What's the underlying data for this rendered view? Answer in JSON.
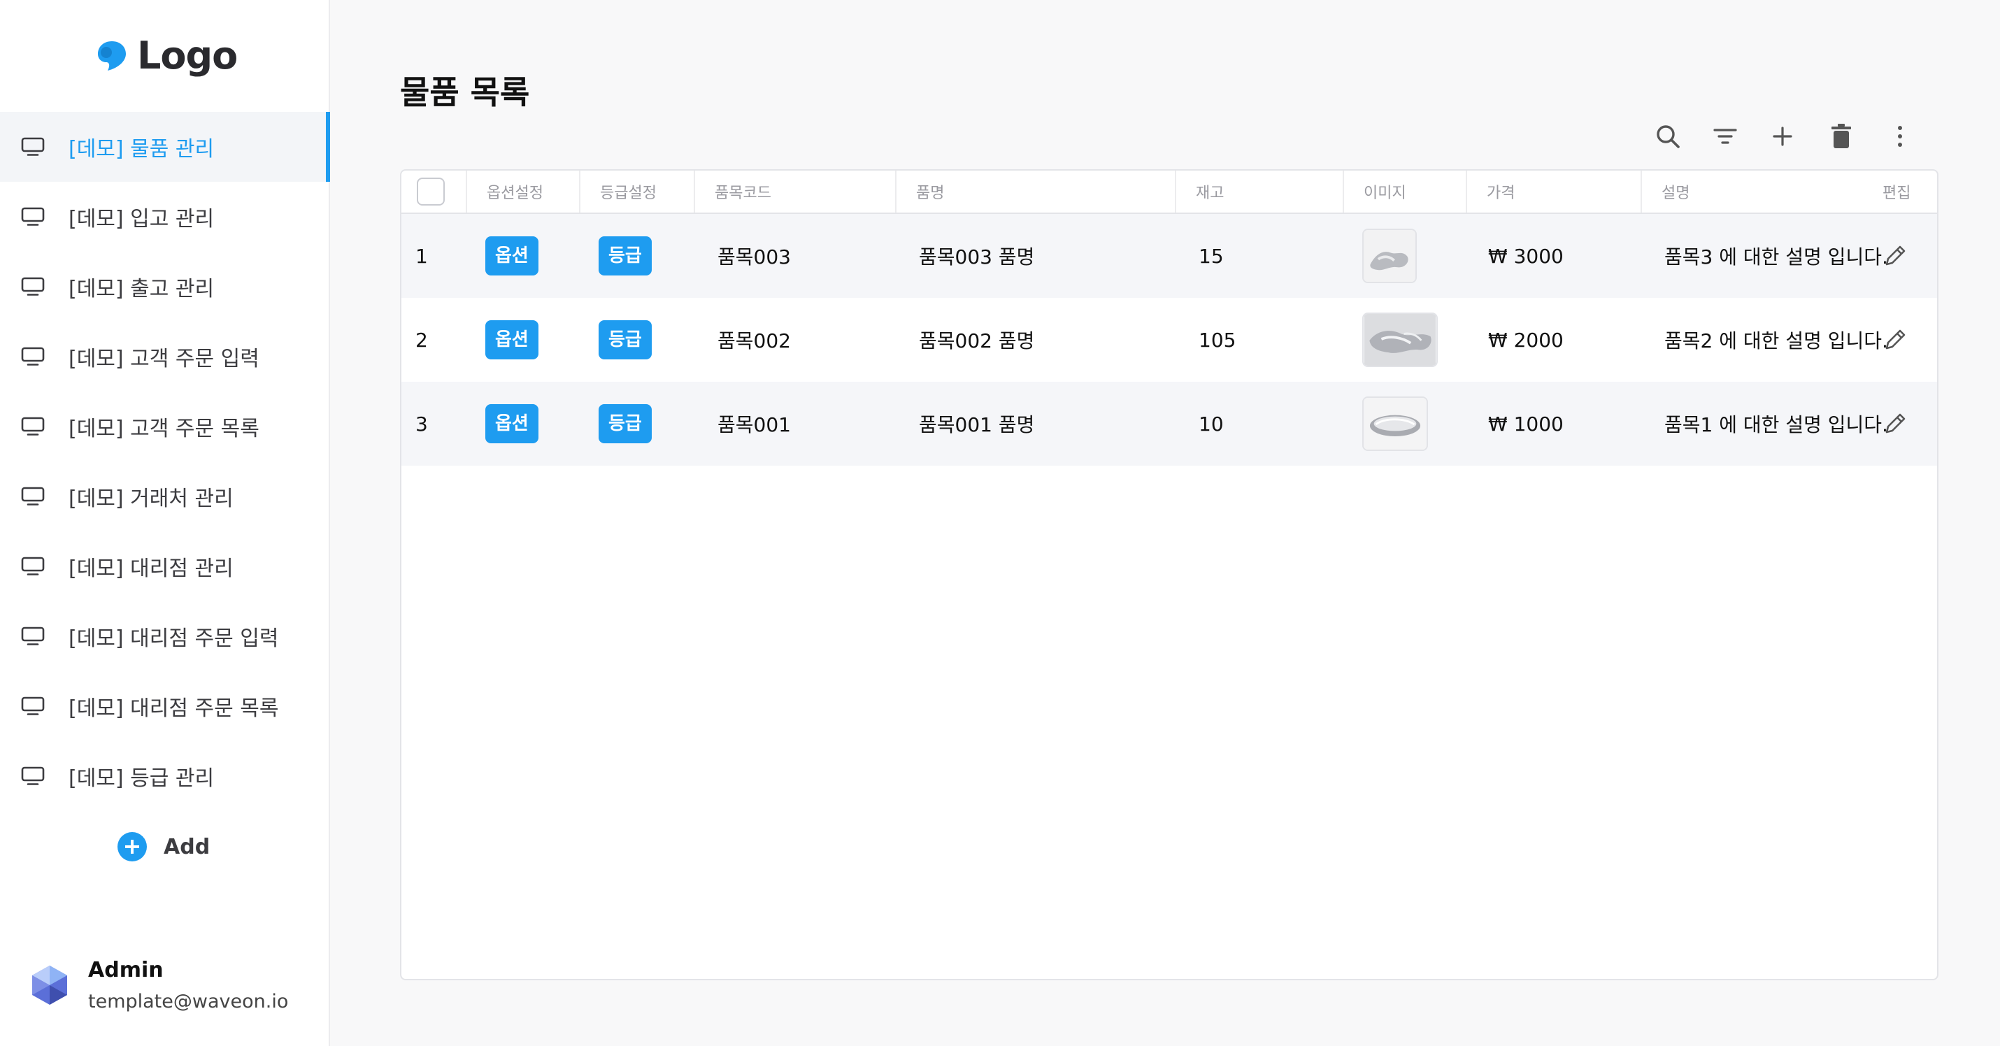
{
  "brand": {
    "logo_text": "Logo",
    "accent": "#1e9cf0"
  },
  "sidebar": {
    "items": [
      {
        "label": "[데모] 물품 관리",
        "active": true
      },
      {
        "label": "[데모] 입고 관리"
      },
      {
        "label": "[데모] 출고 관리"
      },
      {
        "label": "[데모] 고객 주문 입력"
      },
      {
        "label": "[데모] 고객 주문 목록"
      },
      {
        "label": "[데모] 거래처 관리"
      },
      {
        "label": "[데모] 대리점 관리"
      },
      {
        "label": "[데모] 대리점 주문 입력"
      },
      {
        "label": "[데모] 대리점 주문 목록"
      },
      {
        "label": "[데모] 등급 관리"
      }
    ],
    "add_label": "Add",
    "icon": "monitor-icon"
  },
  "user": {
    "name": "Admin",
    "email": "template@waveon.io"
  },
  "page": {
    "title": "물품 목록"
  },
  "toolbar": {
    "icons": [
      "search-icon",
      "filter-icon",
      "plus-icon",
      "trash-icon",
      "more-vertical-icon"
    ]
  },
  "table": {
    "headers": {
      "option": "옵션설정",
      "grade": "등급설정",
      "code": "품목코드",
      "name": "품명",
      "stock": "재고",
      "image": "이미지",
      "price": "가격",
      "desc": "설명",
      "edit": "편집"
    },
    "rows": [
      {
        "no": "1",
        "option": "옵션",
        "grade": "등급",
        "code": "품목003",
        "name": "품목003 품명",
        "stock": "15",
        "price": "₩  3000",
        "desc": "품목3 에 대한 설명 입니다."
      },
      {
        "no": "2",
        "option": "옵션",
        "grade": "등급",
        "code": "품목002",
        "name": "품목002 품명",
        "stock": "105",
        "price": "₩  2000",
        "desc": "품목2 에 대한 설명 입니다."
      },
      {
        "no": "3",
        "option": "옵션",
        "grade": "등급",
        "code": "품목001",
        "name": "품목001 품명",
        "stock": "10",
        "price": "₩  1000",
        "desc": "품목1 에 대한 설명 입니다."
      }
    ]
  }
}
